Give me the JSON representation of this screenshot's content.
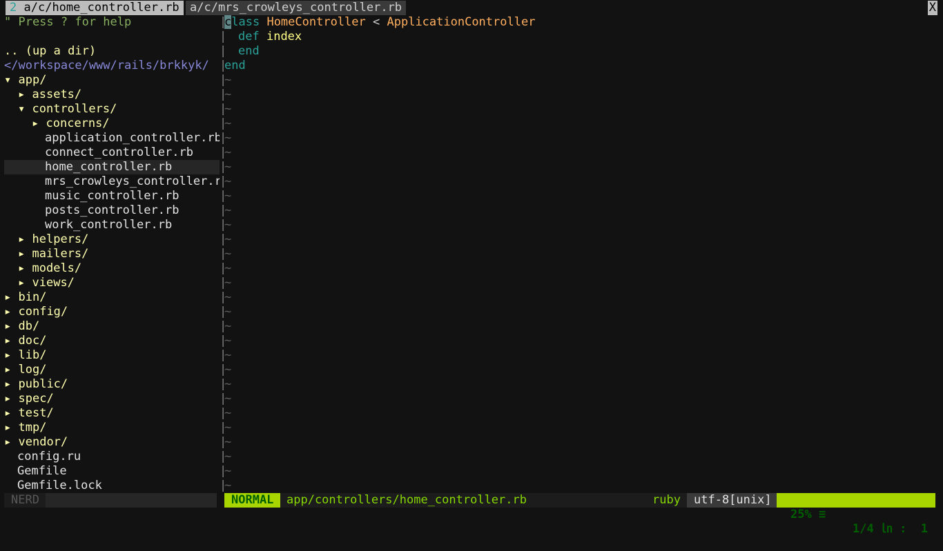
{
  "tabs": [
    {
      "num": "2",
      "label": "a/c/home_controller.rb",
      "active": true
    },
    {
      "label": "a/c/mrs_crowleys_controller.rb",
      "active": false
    }
  ],
  "close_label": "X",
  "tree": {
    "help": "\" Press ? for help",
    "updir": ".. (up a dir)",
    "root": "</workspace/www/rails/brkkyk/",
    "arrow_open": "▾",
    "arrow_closed": "▸",
    "items": {
      "app": "app/",
      "assets": "assets/",
      "controllers": "controllers/",
      "concerns": "concerns/",
      "application_controller": "application_controller.rb",
      "connect_controller": "connect_controller.rb",
      "home_controller": "home_controller.rb",
      "mrs_crowleys_controller": "mrs_crowleys_controller.r",
      "music_controller": "music_controller.rb",
      "posts_controller": "posts_controller.rb",
      "work_controller": "work_controller.rb",
      "helpers": "helpers/",
      "mailers": "mailers/",
      "models": "models/",
      "views": "views/",
      "bin": "bin/",
      "config": "config/",
      "db": "db/",
      "doc": "doc/",
      "lib": "lib/",
      "log": "log/",
      "public": "public/",
      "spec": "spec/",
      "test": "test/",
      "tmp": "tmp/",
      "vendor": "vendor/",
      "config_ru": "config.ru",
      "gemfile": "Gemfile",
      "gemfile_lock": "Gemfile.lock"
    }
  },
  "editor": {
    "line1": {
      "cursor_char": "c",
      "kw_rest": "lass",
      "class_name": "HomeController",
      "op": "<",
      "parent": "ApplicationController"
    },
    "line2": {
      "kw": "def",
      "name": "index"
    },
    "line3": {
      "kw": "end"
    },
    "line4": {
      "kw": "end"
    },
    "tilde": "~"
  },
  "status": {
    "nerd_label": "NERD",
    "mode": "NORMAL",
    "filepath": "app/controllers/home_controller.rb",
    "filetype": "ruby",
    "encoding": "utf-8[unix]",
    "percent": "25% ≡",
    "lineinfo": "1/4 ㏑ :  1"
  },
  "colors": {
    "keyword": "#2aa198",
    "class": "#ffaf5f",
    "directory": "#ffffaf",
    "mode_bg": "#a8d400"
  }
}
